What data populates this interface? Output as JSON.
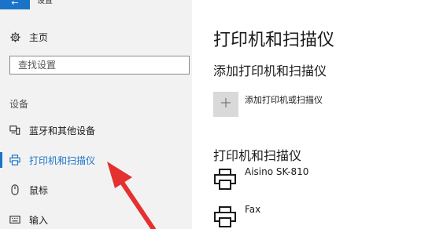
{
  "titlebar": {
    "back_glyph": "←",
    "title": "设置"
  },
  "sidebar": {
    "home_label": "主页",
    "search_placeholder": "查找设置",
    "section_label": "设备",
    "items": [
      {
        "label": "蓝牙和其他设备",
        "icon": "bluetooth-devices-icon"
      },
      {
        "label": "打印机和扫描仪",
        "icon": "printer-icon",
        "active": true
      },
      {
        "label": "鼠标",
        "icon": "mouse-icon"
      },
      {
        "label": "输入",
        "icon": "keyboard-icon"
      }
    ]
  },
  "main": {
    "page_title": "打印机和扫描仪",
    "add_section_title": "添加打印机和扫描仪",
    "add_label": "添加打印机或扫描仪",
    "list_title": "打印机和扫描仪",
    "devices": [
      {
        "name": "Aisino SK-810"
      },
      {
        "name": "Fax"
      }
    ]
  },
  "colors": {
    "accent": "#1a73c9",
    "sidebar_bg": "#f2f2f2",
    "annotation_arrow": "#e53030"
  }
}
